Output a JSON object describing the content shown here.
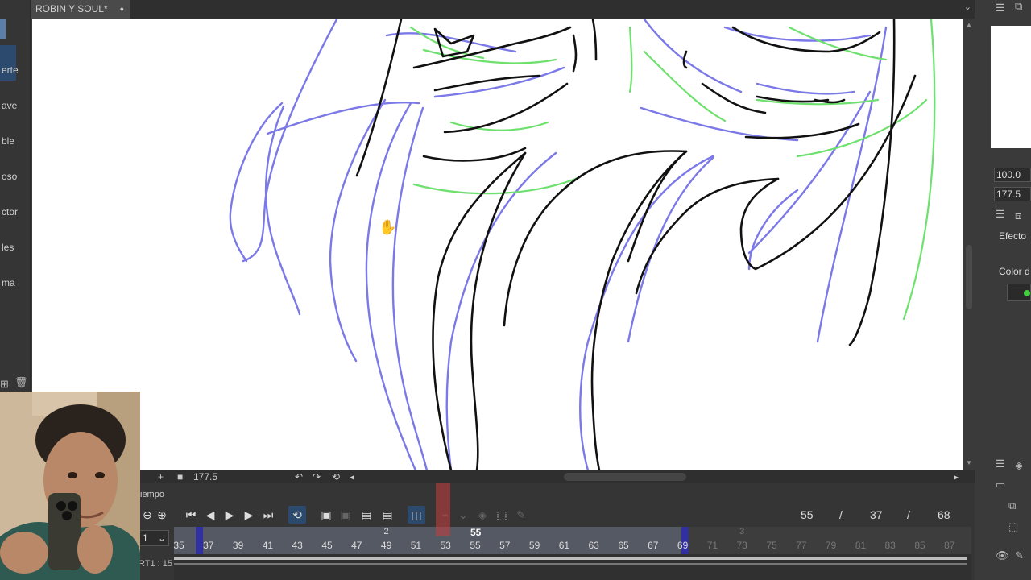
{
  "document_tab": {
    "title": "ROBIN Y SOUL*",
    "close_glyph": "●"
  },
  "left_panel": {
    "items": [
      {
        "label": "erte"
      },
      {
        "label": "ave"
      },
      {
        "label": "ble"
      },
      {
        "label": "oso"
      },
      {
        "label": "ctor"
      },
      {
        "label": "les"
      },
      {
        "label": "ma"
      }
    ]
  },
  "right_panel": {
    "zoom_value": "100.0",
    "angle_value": "177.5",
    "effect_label": "Efecto",
    "color_label": "Color d"
  },
  "status_bar": {
    "zoom": "177.5"
  },
  "timeline": {
    "title": "iempo",
    "frame_current": "55",
    "frame_sep1": "/",
    "frame_total_a": "37",
    "frame_sep2": "/",
    "frame_total_b": "68",
    "layer_select": "1",
    "track_label": "RT1 : 15",
    "playhead_label": "55",
    "ruler_ticks": [
      "35",
      "37",
      "39",
      "41",
      "43",
      "45",
      "47",
      "49",
      "51",
      "53",
      "55",
      "57",
      "59",
      "61",
      "63",
      "65",
      "67",
      "69",
      "71",
      "73",
      "75",
      "77",
      "79",
      "81",
      "83",
      "85",
      "87"
    ],
    "ruler_markers": [
      {
        "label": "2",
        "frame": "49"
      },
      {
        "label": "3",
        "frame": "73"
      }
    ]
  },
  "accent_colors": {
    "selection": "#2c4a6e",
    "range_marker": "#3030a0",
    "playhead": "#c83c3c",
    "sketch_blue": "#7b78e8",
    "sketch_green": "#6ee06e",
    "ink": "#111111"
  }
}
